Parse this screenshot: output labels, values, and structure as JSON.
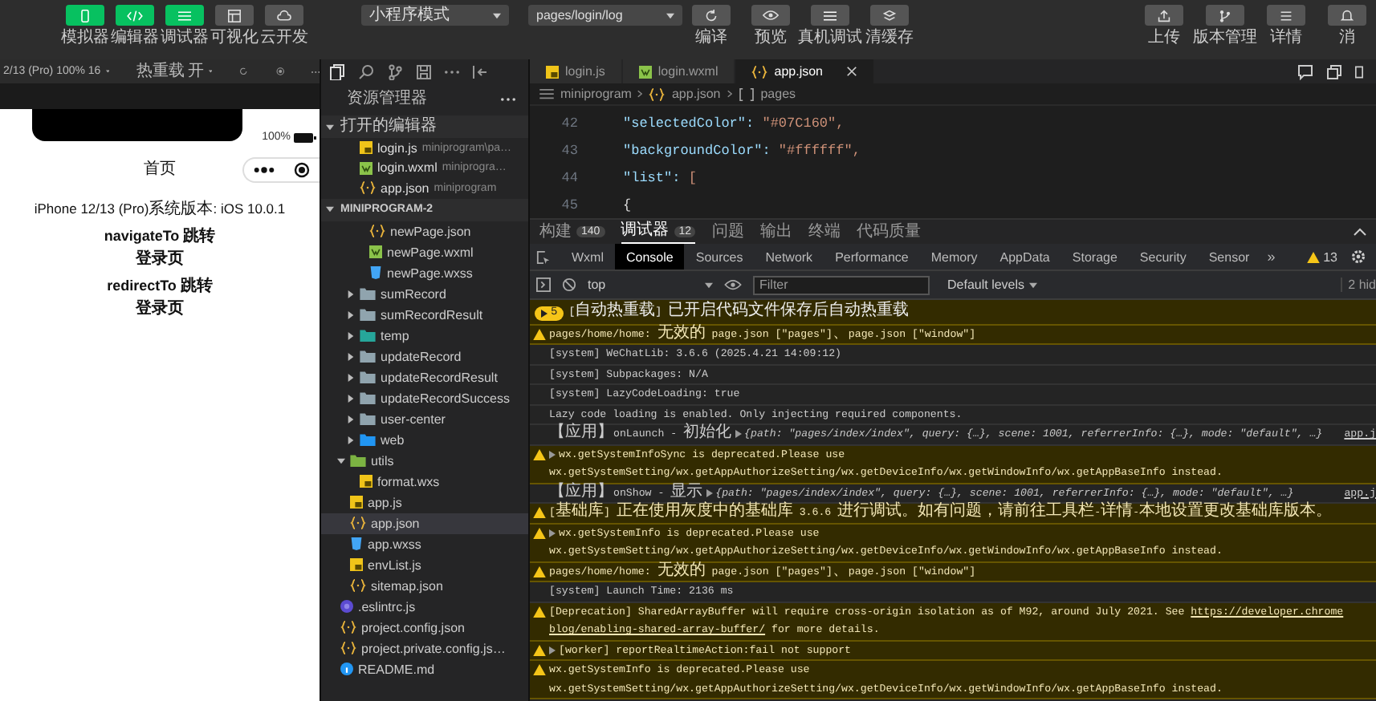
{
  "toolbar": {
    "left_buttons": [
      {
        "label": "模拟器",
        "kind": "phone",
        "selected": true
      },
      {
        "label": "编辑器",
        "kind": "code",
        "selected": true
      },
      {
        "label": "调试器",
        "kind": "debug",
        "selected": true
      },
      {
        "label": "可视化",
        "kind": "layout",
        "selected": false
      },
      {
        "label": "云开发",
        "kind": "cloud",
        "selected": false
      }
    ],
    "mode_select": "小程序模式",
    "page_select": "pages/login/log",
    "center_buttons": [
      {
        "label": "编译",
        "kind": "compile"
      },
      {
        "label": "预览",
        "kind": "eye"
      },
      {
        "label": "真机调试",
        "kind": "debug"
      },
      {
        "label": "清缓存",
        "kind": "layers"
      }
    ],
    "right_buttons": [
      {
        "label": "上传",
        "kind": "upload"
      },
      {
        "label": "版本管理",
        "kind": "branch"
      },
      {
        "label": "详情",
        "kind": "menu"
      },
      {
        "label": "消",
        "kind": "bell"
      }
    ]
  },
  "simulator": {
    "device": "2/13 (Pro) 100% 16",
    "hot_reload": "热重载 开",
    "battery": "100%",
    "nav_title": "首页",
    "device_info": "iPhone 12/13 (Pro)系统版本: iOS 10.0.1",
    "links": [
      {
        "label": "navigateTo 跳转",
        "sub": "登录页"
      },
      {
        "label": "redirectTo 跳转",
        "sub": "登录页"
      }
    ]
  },
  "explorer": {
    "title": "资源管理器",
    "open_editors": {
      "title": "打开的编辑器",
      "expanded": true,
      "files": [
        {
          "name": "login.js",
          "path": "miniprogram\\pa…",
          "kind": "js"
        },
        {
          "name": "login.wxml",
          "path": "miniprogra…",
          "kind": "wxml"
        },
        {
          "name": "app.json",
          "path": "miniprogram",
          "kind": "json"
        }
      ]
    },
    "project": {
      "title": "MINIPROGRAM-2",
      "expanded": true,
      "tree": [
        {
          "children": [
            {
              "children": [
                {
                  "children": [
                    {
                      "name": "newPage.json",
                      "kind": "json",
                      "selected": false
                    },
                    {
                      "name": "newPage.wxml",
                      "kind": "wxml",
                      "selected": false
                    },
                    {
                      "name": "newPage.wxss",
                      "kind": "wxss",
                      "selected": false
                    }
                  ]
                },
                {
                  "name": "sumRecord",
                  "kind": "folder",
                  "color": "#90a4ae",
                  "expanded": false,
                  "selected": false
                },
                {
                  "name": "sumRecordResult",
                  "kind": "folder",
                  "color": "#90a4ae",
                  "expanded": false,
                  "selected": false
                },
                {
                  "name": "temp",
                  "kind": "folder",
                  "color": "#26a69a",
                  "expanded": false,
                  "selected": false
                },
                {
                  "name": "updateRecord",
                  "kind": "folder",
                  "color": "#90a4ae",
                  "expanded": false,
                  "selected": false
                },
                {
                  "name": "updateRecordResult",
                  "kind": "folder",
                  "color": "#90a4ae",
                  "expanded": false,
                  "selected": false
                },
                {
                  "name": "updateRecordSuccess",
                  "kind": "folder",
                  "color": "#90a4ae",
                  "expanded": false,
                  "selected": false
                },
                {
                  "name": "user-center",
                  "kind": "folder",
                  "color": "#90a4ae",
                  "expanded": false,
                  "selected": false
                },
                {
                  "name": "web",
                  "kind": "folder",
                  "color": "#2196f3",
                  "expanded": false,
                  "selected": false
                }
              ]
            },
            {
              "name": "utils",
              "kind": "folder",
              "color": "#7cb342",
              "expanded": true,
              "selected": false,
              "children": [
                {
                  "name": "format.wxs",
                  "kind": "js",
                  "selected": false
                }
              ]
            },
            {
              "name": "app.js",
              "kind": "js",
              "selected": false
            },
            {
              "name": "app.json",
              "kind": "json",
              "selected": true
            },
            {
              "name": "app.wxss",
              "kind": "wxss",
              "selected": false
            },
            {
              "name": "envList.js",
              "kind": "js",
              "selected": false
            },
            {
              "name": "sitemap.json",
              "kind": "json",
              "selected": false
            }
          ]
        },
        {
          "name": ".eslintrc.js",
          "kind": "eslint",
          "selected": false
        },
        {
          "name": "project.config.json",
          "kind": "json",
          "selected": false
        },
        {
          "name": "project.private.config.js…",
          "kind": "json",
          "selected": false
        },
        {
          "name": "README.md",
          "kind": "info",
          "selected": false
        }
      ]
    }
  },
  "editor": {
    "tabs": [
      {
        "name": "login.js",
        "kind": "js",
        "selected": false
      },
      {
        "name": "login.wxml",
        "kind": "wxml",
        "selected": false
      },
      {
        "name": "app.json",
        "kind": "json",
        "selected": true
      }
    ],
    "breadcrumb": [
      {
        "text": "miniprogram",
        "kind": "folder"
      },
      {
        "text": "app.json",
        "kind": "json"
      },
      {
        "text": "pages",
        "kind": "array"
      }
    ],
    "code_lines": [
      {
        "number": "42",
        "key": "\"selectedColor\":",
        "value": " \"#07C160\","
      },
      {
        "number": "43",
        "key": "\"backgroundColor\":",
        "value": " \"#ffffff\","
      },
      {
        "number": "44",
        "key": "\"list\":",
        "value": " ["
      },
      {
        "number": "45",
        "punct": "{"
      }
    ]
  },
  "panel_tabs": [
    {
      "label": "构建",
      "count": "140",
      "selected": false
    },
    {
      "label": "调试器",
      "count": "12",
      "selected": true
    },
    {
      "label": "问题",
      "selected": false
    },
    {
      "label": "输出",
      "selected": false
    },
    {
      "label": "终端",
      "selected": false
    },
    {
      "label": "代码质量",
      "selected": false
    }
  ],
  "devtools": {
    "tabs": [
      {
        "label": "Wxml",
        "selected": false
      },
      {
        "label": "Console",
        "selected": true
      },
      {
        "label": "Sources",
        "selected": false
      },
      {
        "label": "Network",
        "selected": false
      },
      {
        "label": "Performance",
        "selected": false
      },
      {
        "label": "Memory",
        "selected": false
      },
      {
        "label": "AppData",
        "selected": false
      },
      {
        "label": "Storage",
        "selected": false
      },
      {
        "label": "Security",
        "selected": false
      },
      {
        "label": "Sensor",
        "selected": false
      }
    ],
    "more": "»",
    "warnings": "13"
  },
  "console": {
    "context": "top",
    "filter_placeholder": "Filter",
    "levels": "Default levels",
    "hidden": "2 hid",
    "rows": [
      {
        "kind": "group",
        "badge": "5",
        "expandable": false,
        "lines": [
          "[自动热重载] 已开启代码文件保存后自动热重载"
        ]
      },
      {
        "kind": "warn",
        "expandable": false,
        "lines": [
          "pages/home/home: 无效的 page.json [\"pages\"]、page.json [\"window\"]"
        ]
      },
      {
        "kind": "log",
        "expandable": false,
        "lines": [
          "[system] WeChatLib: 3.6.6 (2025.4.21 14:09:12)"
        ]
      },
      {
        "kind": "log",
        "expandable": false,
        "lines": [
          "[system] Subpackages: N/A"
        ]
      },
      {
        "kind": "log",
        "expandable": false,
        "lines": [
          "[system] LazyCodeLoading: true"
        ]
      },
      {
        "kind": "log",
        "expandable": false,
        "lines": [
          "Lazy code loading is enabled. Only injecting required components."
        ]
      },
      {
        "kind": "object",
        "expandable": true,
        "text": "【应用】onLaunch - 初始化",
        "object": "{path: \"pages/index/index\", query: {…}, scene: 1001, referrerInfo: {…}, mode: \"default\", …}",
        "source": "app.j"
      },
      {
        "kind": "warn",
        "expandable": true,
        "lines": [
          "wx.getSystemInfoSync is deprecated.Please use",
          "wx.getSystemSetting/wx.getAppAuthorizeSetting/wx.getDeviceInfo/wx.getWindowInfo/wx.getAppBaseInfo instead."
        ]
      },
      {
        "kind": "object",
        "expandable": true,
        "text": "【应用】onShow - 显示",
        "object": "{path: \"pages/index/index\", query: {…}, scene: 1001, referrerInfo: {…}, mode: \"default\", …}",
        "source": "app.j"
      },
      {
        "kind": "warn",
        "expandable": false,
        "lines": [
          "[基础库] 正在使用灰度中的基础库 3.6.6 进行调试。如有问题，请前往工具栏-详情-本地设置更改基础库版本。"
        ]
      },
      {
        "kind": "warn",
        "expandable": true,
        "lines": [
          "wx.getSystemInfo is deprecated.Please use",
          "wx.getSystemSetting/wx.getAppAuthorizeSetting/wx.getDeviceInfo/wx.getWindowInfo/wx.getAppBaseInfo instead."
        ]
      },
      {
        "kind": "warn",
        "expandable": false,
        "lines": [
          "pages/home/home: 无效的 page.json [\"pages\"]、page.json [\"window\"]"
        ]
      },
      {
        "kind": "log",
        "expandable": false,
        "lines": [
          "[system] Launch Time: 2136 ms"
        ]
      },
      {
        "kind": "warn",
        "expandable": false,
        "lines": [
          [
            {
              "text": "[Deprecation] SharedArrayBuffer will require cross-origin isolation as of M92, around July 2021. See "
            },
            {
              "text": "https://developer.chrome",
              "link": true
            }
          ],
          [
            {
              "text": "blog/enabling-shared-array-buffer/",
              "link": true
            },
            {
              "text": " for more details."
            }
          ]
        ]
      },
      {
        "kind": "warn",
        "expandable": true,
        "lines": [
          "[worker] reportRealtimeAction:fail not support"
        ]
      },
      {
        "kind": "warn",
        "expandable": false,
        "lines": [
          "wx.getSystemInfo is deprecated.Please use",
          "wx.getSystemSetting/wx.getAppAuthorizeSetting/wx.getDeviceInfo/wx.getWindowInfo/wx.getAppBaseInfo instead."
        ]
      }
    ]
  }
}
